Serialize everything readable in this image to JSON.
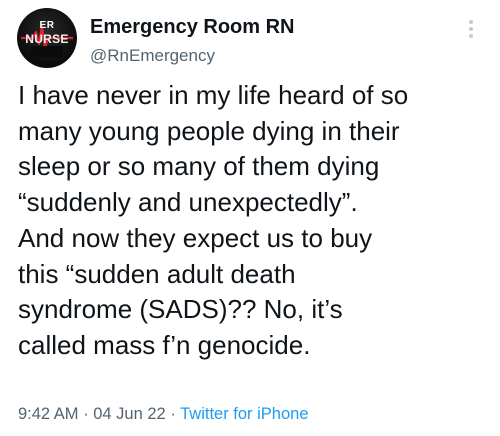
{
  "author": {
    "display_name": "Emergency Room RN",
    "handle": "@RnEmergency",
    "avatar_text_top": "ER",
    "avatar_text_bottom": "NURSE"
  },
  "tweet": {
    "lines": [
      "I have never in my life heard of so",
      "many young people dying in their",
      "sleep or so many of them dying",
      "“suddenly and unexpectedly”.",
      "And now they expect us to buy",
      "this “sudden adult death",
      "syndrome (SADS)?? No, it’s",
      "called mass f’n genocide."
    ],
    "time": "9:42 AM",
    "separator": "·",
    "date": "04 Jun 22",
    "source": "Twitter for iPhone"
  },
  "icons": {
    "more": "vertical-dots-icon",
    "avatar_accent": "#d7262f"
  },
  "colors": {
    "text": "#0f1419",
    "muted": "#536471",
    "link": "#1d9bf0"
  }
}
